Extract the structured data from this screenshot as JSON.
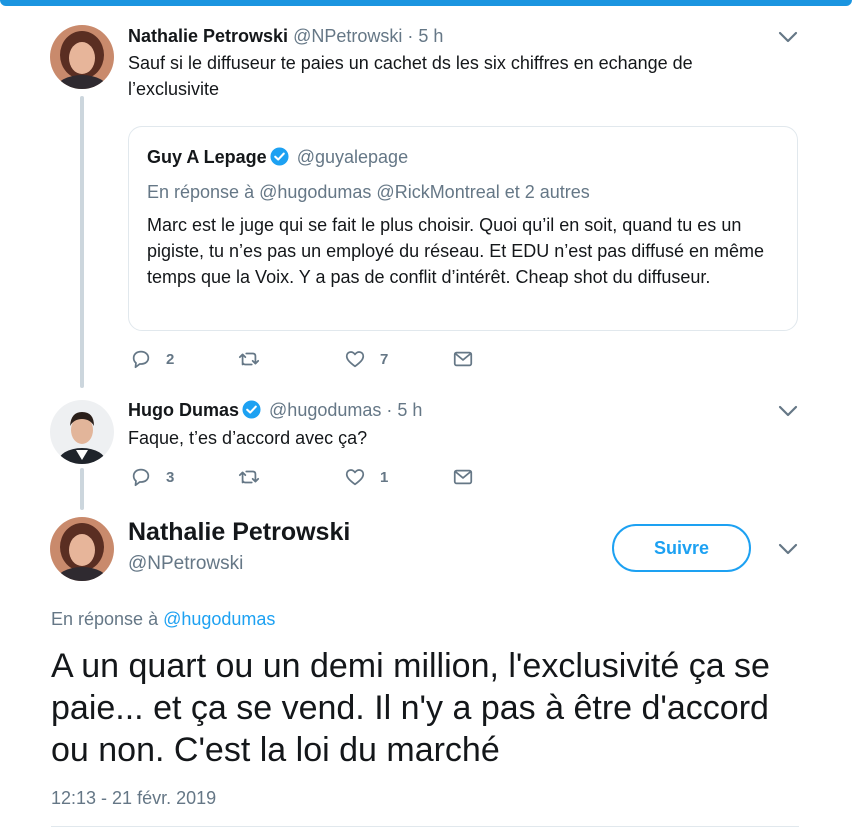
{
  "tweets": [
    {
      "name": "Nathalie Petrowski",
      "handle": "@NPetrowski",
      "separator": "·",
      "time": "5 h",
      "text": "Sauf si le diffuseur te paies un cachet ds les six chiffres en echange de l’exclusivite",
      "quote": {
        "name": "Guy A Lepage",
        "verified": true,
        "handle": "@guyalepage",
        "reply_to": "En réponse à @hugodumas @RickMontreal et 2 autres",
        "text": "Marc est le juge qui se fait le plus choisir. Quoi qu’il en soit, quand tu es un pigiste, tu n’es pas un employé du réseau. Et EDU n’est pas diffusé en même temps que la Voix. Y a pas de conflit d’intérêt. Cheap shot du diffuseur."
      },
      "replies": "2",
      "retweets": "",
      "likes": "7"
    },
    {
      "name": "Hugo Dumas",
      "verified": true,
      "handle": "@hugodumas",
      "separator": "·",
      "time": "5 h",
      "text": "Faque, t’es d’accord avec ça?",
      "replies": "3",
      "retweets": "",
      "likes": "1"
    }
  ],
  "main_tweet": {
    "name": "Nathalie Petrowski",
    "handle": "@NPetrowski",
    "follow_label": "Suivre",
    "reply_prefix": "En réponse à",
    "reply_handle": "@hugodumas",
    "text": "A un quart ou un demi million, l'exclusivité ça se paie... et ça se vend. Il n'y a pas à être d'accord ou non. C'est la loi du marché",
    "timestamp": "12:13 - 21 févr. 2019"
  },
  "icons": {
    "reply": "reply-icon",
    "retweet": "retweet-icon",
    "like": "heart-icon",
    "dm": "envelope-icon",
    "more": "chevron-down-icon",
    "verified": "verified-badge-icon"
  },
  "colors": {
    "accent": "#1da1f2",
    "muted": "#657786",
    "text": "#14171a",
    "border": "#e1e8ed"
  }
}
